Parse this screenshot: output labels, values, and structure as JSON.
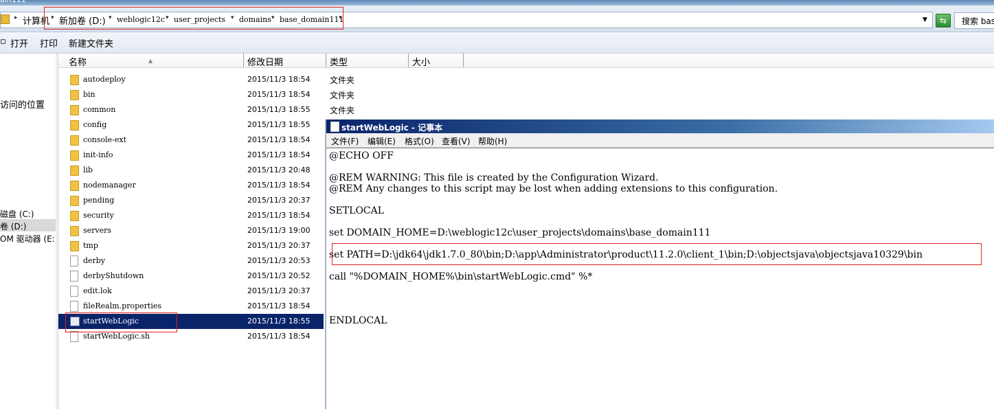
{
  "window_title": "ain111",
  "address": {
    "crumbs": [
      "计算机",
      "新加卷 (D:)",
      "weblogic12c",
      "user_projects",
      "domains",
      "base_domain111"
    ],
    "search_placeholder": "搜索 bas"
  },
  "toolbar": {
    "open_label": "打开",
    "print_label": "打印",
    "new_folder_label": "新建文件夹"
  },
  "nav": {
    "recent_places": "访问的位置",
    "disk_c": "磁盘 (C:)",
    "disk_d": "卷 (D:)",
    "dvd_e": "OM 驱动器 (E:)"
  },
  "columns": {
    "name": "名称",
    "date": "修改日期",
    "type": "类型",
    "size": "大小"
  },
  "files": [
    {
      "name": "autodeploy",
      "date": "2015/11/3 18:54",
      "type": "文件夹",
      "icon": "folder-icon"
    },
    {
      "name": "bin",
      "date": "2015/11/3 18:54",
      "type": "文件夹",
      "icon": "folder-icon"
    },
    {
      "name": "common",
      "date": "2015/11/3 18:55",
      "type": "文件夹",
      "icon": "folder-icon"
    },
    {
      "name": "config",
      "date": "2015/11/3 18:55",
      "type": "",
      "icon": "folder-icon"
    },
    {
      "name": "console-ext",
      "date": "2015/11/3 18:54",
      "type": "",
      "icon": "folder-icon"
    },
    {
      "name": "init-info",
      "date": "2015/11/3 18:54",
      "type": "",
      "icon": "folder-icon"
    },
    {
      "name": "lib",
      "date": "2015/11/3 20:48",
      "type": "",
      "icon": "folder-icon"
    },
    {
      "name": "nodemanager",
      "date": "2015/11/3 18:54",
      "type": "",
      "icon": "folder-icon"
    },
    {
      "name": "pending",
      "date": "2015/11/3 20:37",
      "type": "",
      "icon": "folder-icon"
    },
    {
      "name": "security",
      "date": "2015/11/3 18:54",
      "type": "",
      "icon": "folder-icon"
    },
    {
      "name": "servers",
      "date": "2015/11/3 19:00",
      "type": "",
      "icon": "folder-icon"
    },
    {
      "name": "tmp",
      "date": "2015/11/3 20:37",
      "type": "",
      "icon": "folder-icon"
    },
    {
      "name": "derby",
      "date": "2015/11/3 20:53",
      "type": "",
      "icon": "script-file-icon"
    },
    {
      "name": "derbyShutdown",
      "date": "2015/11/3 20:52",
      "type": "",
      "icon": "script-file-icon"
    },
    {
      "name": "edit.lok",
      "date": "2015/11/3 20:37",
      "type": "",
      "icon": "file-icon"
    },
    {
      "name": "fileRealm.properties",
      "date": "2015/11/3 18:54",
      "type": "",
      "icon": "file-icon"
    },
    {
      "name": "startWebLogic",
      "date": "2015/11/3 18:55",
      "type": "",
      "icon": "cmd-file-icon",
      "selected": true
    },
    {
      "name": "startWebLogic.sh",
      "date": "2015/11/3 18:54",
      "type": "",
      "icon": "file-icon"
    }
  ],
  "notepad": {
    "title": "startWebLogic - 记事本",
    "menu": [
      "文件(F)",
      "编辑(E)",
      "格式(O)",
      "查看(V)",
      "帮助(H)"
    ],
    "lines": [
      "@ECHO OFF",
      "",
      "@REM WARNING: This file is created by the Configuration Wizard.",
      "@REM Any changes to this script may be lost when adding extensions to this configuration.",
      "",
      "SETLOCAL",
      "",
      "set DOMAIN_HOME=D:\\weblogic12c\\user_projects\\domains\\base_domain111",
      "",
      "set PATH=D:\\jdk64\\jdk1.7.0_80\\bin;D:\\app\\Administrator\\product\\11.2.0\\client_1\\bin;D:\\objectsjava\\objectsjava10329\\bin",
      "",
      "call \"%DOMAIN_HOME%\\bin\\startWebLogic.cmd\" %*",
      "",
      "",
      "",
      "ENDLOCAL"
    ]
  },
  "colors": {
    "highlight": "#e02020",
    "selection": "#0a246a"
  }
}
